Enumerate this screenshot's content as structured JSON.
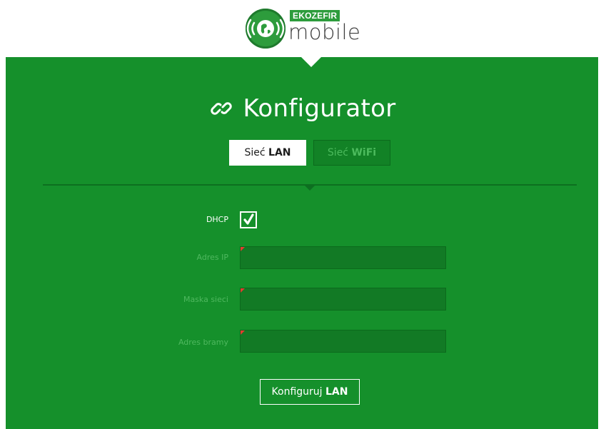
{
  "logo": {
    "brand": "EKOZEFIR",
    "product": "mobile"
  },
  "header": {
    "title": "Konfigurator",
    "title_icon": "link-icon"
  },
  "tabs": [
    {
      "prefix": "Sieć",
      "strong": "LAN",
      "active": true
    },
    {
      "prefix": "Sieć",
      "strong": "WiFi",
      "active": false
    }
  ],
  "form": {
    "dhcp": {
      "label": "DHCP",
      "checked": true
    },
    "ip": {
      "label": "Adres IP",
      "value": ""
    },
    "mask": {
      "label": "Maska sieci",
      "value": ""
    },
    "gateway": {
      "label": "Adres bramy",
      "value": ""
    }
  },
  "submit": {
    "prefix": "Konfiguruj",
    "strong": "LAN"
  },
  "colors": {
    "panel": "#15902b",
    "field_bg": "#127a25",
    "required_marker": "#e53a2f",
    "inactive_text": "#4fb85f"
  }
}
